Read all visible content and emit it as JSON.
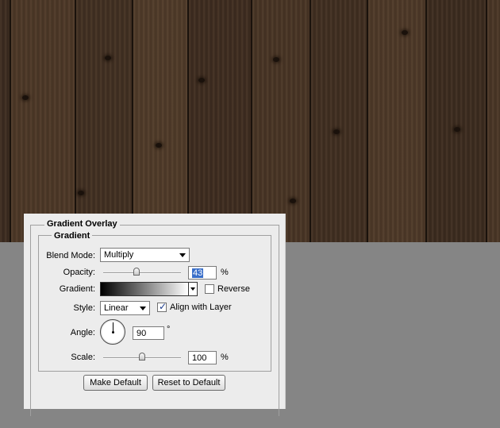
{
  "panel": {
    "title": "Gradient Overlay",
    "section": "Gradient",
    "blend_mode": {
      "label": "Blend Mode:",
      "value": "Multiply"
    },
    "opacity": {
      "label": "Opacity:",
      "value": "43",
      "unit": "%",
      "level": 0.43
    },
    "gradient": {
      "label": "Gradient:",
      "reverse_label": "Reverse",
      "reverse_checked": false
    },
    "style": {
      "label": "Style:",
      "value": "Linear",
      "align_label": "Align with Layer",
      "align_checked": true
    },
    "angle": {
      "label": "Angle:",
      "value": "90",
      "unit": "°"
    },
    "scale": {
      "label": "Scale:",
      "value": "100",
      "unit": "%",
      "level": 0.5
    },
    "buttons": {
      "make_default": "Make Default",
      "reset_default": "Reset to Default"
    }
  }
}
